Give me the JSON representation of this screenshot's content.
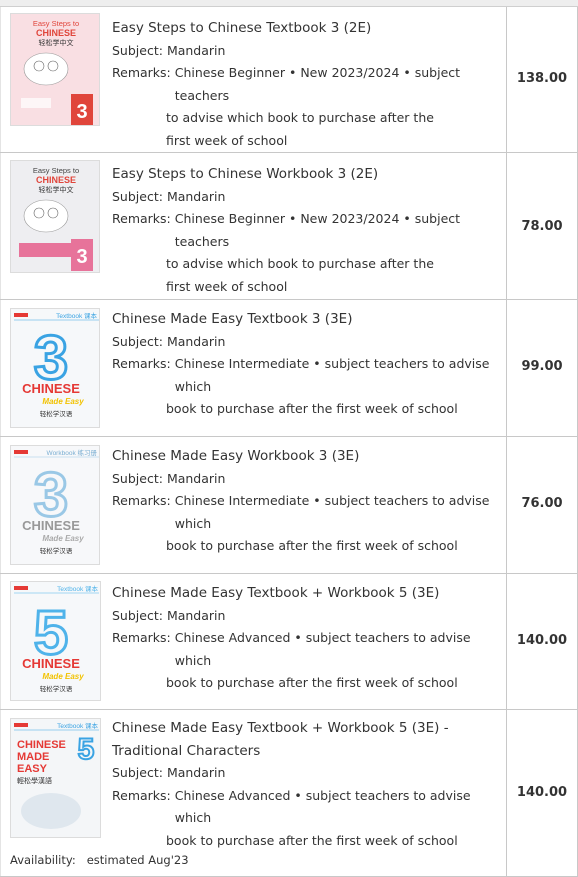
{
  "rows": [
    {
      "title": "Easy Steps to Chinese Textbook 3 (2E)",
      "subject_label": "Subject:",
      "subject": "Mandarin",
      "remarks_label": "Remarks:",
      "remarks_line1": "Chinese Beginner • New 2023/2024 • subject teachers",
      "remarks_rest": [
        "to advise which book to purchase after the",
        "first week of school"
      ],
      "price": "138.00",
      "cover": {
        "top_text": "Easy Steps to",
        "brand": "CHINESE",
        "cn": "轻松学中文",
        "num": "3",
        "accent": "#e0453b"
      }
    },
    {
      "title": "Easy Steps to Chinese Workbook 3 (2E)",
      "subject_label": "Subject:",
      "subject": "Mandarin",
      "remarks_label": "Remarks:",
      "remarks_line1": "Chinese Beginner • New 2023/2024 • subject teachers",
      "remarks_rest": [
        "to advise which book to purchase after the",
        "first week of school"
      ],
      "price": "78.00",
      "cover": {
        "top_text": "Easy Steps to",
        "brand": "CHINESE",
        "cn": "轻松学中文",
        "num": "3",
        "accent": "#e7739a"
      }
    },
    {
      "title": "Chinese Made Easy Textbook 3 (3E)",
      "subject_label": "Subject:",
      "subject": "Mandarin",
      "remarks_label": "Remarks:",
      "remarks_line1": "Chinese Intermediate • subject teachers to advise which",
      "remarks_rest": [
        "book to purchase after the first week of school"
      ],
      "price": "99.00",
      "cover": {
        "kind": "Textbook 课本",
        "num": "3",
        "brand": "CHINESE",
        "sub": "Made Easy",
        "cn": "轻松学汉语",
        "accent": "#3aa3e3"
      }
    },
    {
      "title": "Chinese Made Easy Workbook 3 (3E)",
      "subject_label": "Subject:",
      "subject": "Mandarin",
      "remarks_label": "Remarks:",
      "remarks_line1": "Chinese Intermediate • subject teachers to advise which",
      "remarks_rest": [
        "book to purchase after the first week of school"
      ],
      "price": "76.00",
      "cover": {
        "kind": "Workbook 练习册",
        "num": "3",
        "brand": "CHINESE",
        "sub": "Made Easy",
        "cn": "轻松学汉语",
        "accent": "#9ac8e6"
      }
    },
    {
      "title": "Chinese Made Easy Textbook + Workbook 5 (3E)",
      "subject_label": "Subject:",
      "subject": "Mandarin",
      "remarks_label": "Remarks:",
      "remarks_line1": "Chinese Advanced • subject teachers to advise which",
      "remarks_rest": [
        "book to purchase after the first week of school"
      ],
      "price": "140.00",
      "cover": {
        "kind": "Textbook 课本",
        "num": "5",
        "brand": "CHINESE",
        "sub": "Made Easy",
        "cn": "轻松学汉语",
        "accent": "#4fb3ea"
      }
    },
    {
      "title": "Chinese Made Easy Textbook + Workbook 5 (3E) - Traditional Characters",
      "title_line1": "Chinese Made Easy Textbook + Workbook 5 (3E) -",
      "title_line2": "Traditional Characters",
      "subject_label": "Subject:",
      "subject": "Mandarin",
      "remarks_label": "Remarks:",
      "remarks_line1": "Chinese Advanced • subject teachers to advise which",
      "remarks_rest": [
        "book to purchase after the first week of school"
      ],
      "price": "140.00",
      "availability_label": "Availability:",
      "availability": "estimated Aug'23",
      "cover": {
        "kind": "Textbook 课本",
        "num": "5",
        "brand_lines": [
          "CHINESE",
          "MADE",
          "EASY"
        ],
        "cn": "輕松學漢語",
        "accent": "#3aa3e3"
      }
    }
  ],
  "colors": {
    "accent_red": "#e53935",
    "border": "#c8c8c8",
    "text": "#333333"
  }
}
